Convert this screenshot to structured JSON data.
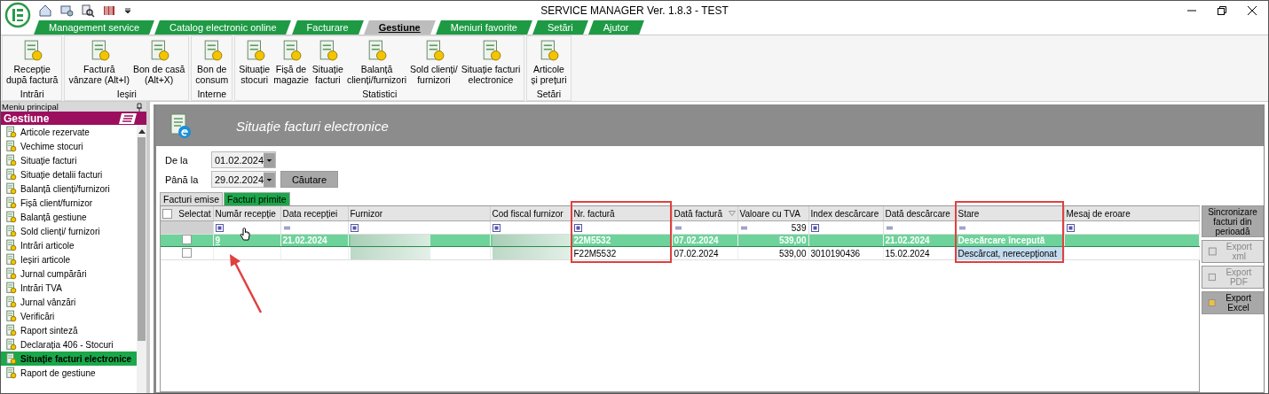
{
  "window": {
    "title": "SERVICE MANAGER Ver. 1.8.3 - TEST"
  },
  "menu_tabs": [
    {
      "label": "Management service",
      "selected": false
    },
    {
      "label": "Catalog electronic online",
      "selected": false
    },
    {
      "label": "Facturare",
      "selected": false
    },
    {
      "label": "Gestiune",
      "selected": true
    },
    {
      "label": "Meniuri favorite",
      "selected": false
    },
    {
      "label": "Setări",
      "selected": false
    },
    {
      "label": "Ajutor",
      "selected": false
    }
  ],
  "ribbon_groups": [
    {
      "label": "Intrări",
      "buttons": [
        {
          "label": "Recepție\ndupă factură"
        }
      ]
    },
    {
      "label": "Ieșiri",
      "buttons": [
        {
          "label": "Factură\nvânzare (Alt+I)"
        },
        {
          "label": "Bon de casă\n(Alt+X)"
        }
      ]
    },
    {
      "label": "Interne",
      "buttons": [
        {
          "label": "Bon de\nconsum"
        }
      ]
    },
    {
      "label": "Statistici",
      "buttons": [
        {
          "label": "Situație\nstocuri"
        },
        {
          "label": "Fișă de\nmagazie"
        },
        {
          "label": "Situație\nfacturi"
        },
        {
          "label": "Balanță\nclienți/furnizori"
        },
        {
          "label": "Sold clienți/\nfurnizori"
        },
        {
          "label": "Situație facturi\nelectronice"
        }
      ]
    },
    {
      "label": "Setări",
      "buttons": [
        {
          "label": "Articole\nși prețuri"
        }
      ]
    }
  ],
  "sidebar": {
    "header": "Meniu principal",
    "section": "Gestiune",
    "items": [
      {
        "label": "Articole rezervate",
        "selected": false
      },
      {
        "label": "Vechime stocuri",
        "selected": false
      },
      {
        "label": "Situație facturi",
        "selected": false
      },
      {
        "label": "Situație detalii facturi",
        "selected": false
      },
      {
        "label": "Balanță clienți/furnizori",
        "selected": false
      },
      {
        "label": "Fișă client/furnizor",
        "selected": false
      },
      {
        "label": "Balanță gestiune",
        "selected": false
      },
      {
        "label": "Sold clienți/ furnizori",
        "selected": false
      },
      {
        "label": "Intrări articole",
        "selected": false
      },
      {
        "label": "Ieșiri articole",
        "selected": false
      },
      {
        "label": "Jurnal cumpărări",
        "selected": false
      },
      {
        "label": "Intrări TVA",
        "selected": false
      },
      {
        "label": "Jurnal vânzări",
        "selected": false
      },
      {
        "label": "Verificări",
        "selected": false
      },
      {
        "label": "Raport sinteză",
        "selected": false
      },
      {
        "label": "Declarația 406 - Stocuri",
        "selected": false
      },
      {
        "label": "Situație facturi electronice",
        "selected": true
      },
      {
        "label": "Raport de gestiune",
        "selected": false
      }
    ]
  },
  "panel": {
    "title": "Situație facturi electronice",
    "filters": [
      {
        "label": "De la",
        "value": "01.02.2024"
      },
      {
        "label": "Până la",
        "value": "29.02.2024"
      }
    ],
    "search_button": "Căutare",
    "tabs": [
      {
        "label": "Facturi emise",
        "selected": false
      },
      {
        "label": "Facturi primite",
        "selected": true
      }
    ],
    "grid": {
      "select_all_checked": false,
      "columns": [
        {
          "label": "Selectat",
          "kind": "plain",
          "highlighted": false
        },
        {
          "label": "Număr recepție",
          "kind": "box",
          "highlighted": false
        },
        {
          "label": "Data recepției",
          "kind": "dash",
          "highlighted": false
        },
        {
          "label": "Furnizor",
          "kind": "box",
          "highlighted": false
        },
        {
          "label": "Cod fiscal furnizor",
          "kind": "box",
          "highlighted": false
        },
        {
          "label": "Nr. factură",
          "kind": "box",
          "highlighted": true
        },
        {
          "label": "Dată factură",
          "kind": "dash",
          "highlighted": false,
          "sorted": true
        },
        {
          "label": "Valoare cu TVA",
          "kind": "dash",
          "highlighted": false,
          "filter_value": "539"
        },
        {
          "label": "Index descărcare",
          "kind": "box",
          "highlighted": false
        },
        {
          "label": "Dată descărcare",
          "kind": "dash",
          "highlighted": false
        },
        {
          "label": "Stare",
          "kind": "dash",
          "highlighted": true
        },
        {
          "label": "Mesaj de eroare",
          "kind": "box",
          "highlighted": false
        }
      ],
      "rows": [
        {
          "selected": true,
          "cells": [
            {
              "kind": "checkbox",
              "checked": false
            },
            {
              "kind": "link",
              "text": "9",
              "arrow": true
            },
            {
              "kind": "text",
              "text": "21.02.2024"
            },
            {
              "kind": "blurred"
            },
            {
              "kind": "blurred"
            },
            {
              "kind": "text",
              "text": "22M5532"
            },
            {
              "kind": "text",
              "text": "07.02.2024"
            },
            {
              "kind": "number",
              "text": "539,00"
            },
            {
              "kind": "empty"
            },
            {
              "kind": "text",
              "text": "21.02.2024"
            },
            {
              "kind": "text",
              "text": "Descărcare începută"
            },
            {
              "kind": "empty"
            }
          ]
        },
        {
          "selected": false,
          "cells": [
            {
              "kind": "checkbox",
              "checked": false
            },
            {
              "kind": "empty"
            },
            {
              "kind": "empty"
            },
            {
              "kind": "blurred"
            },
            {
              "kind": "blurred"
            },
            {
              "kind": "text",
              "text": "F22M5532"
            },
            {
              "kind": "text",
              "text": "07.02.2024"
            },
            {
              "kind": "number",
              "text": "539,00"
            },
            {
              "kind": "text",
              "text": "3010190436"
            },
            {
              "kind": "text",
              "text": "15.02.2024"
            },
            {
              "kind": "text",
              "text": "Descărcat, nerecepționat",
              "focused": true
            },
            {
              "kind": "empty"
            }
          ]
        }
      ]
    },
    "side_buttons": [
      {
        "label": "Sincronizare facturi din perioadă",
        "disabled": false
      },
      {
        "label": "Export xml",
        "disabled": true
      },
      {
        "label": "Export PDF",
        "disabled": true
      },
      {
        "label": "Export Excel",
        "disabled": false
      }
    ]
  }
}
